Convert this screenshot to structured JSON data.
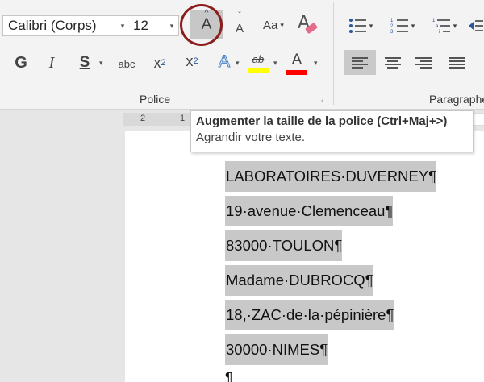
{
  "ribbon": {
    "font_name": "Calibri (Corps)",
    "font_size": "12",
    "change_case_label": "Aa",
    "bold_label": "G",
    "italic_label": "I",
    "underline_label": "S",
    "strike_label": "abc",
    "subscript_base": "x",
    "subscript_mark": "2",
    "superscript_base": "x",
    "superscript_mark": "2",
    "text_effects_label": "A",
    "highlight_label": "ab",
    "font_color_label": "A",
    "groups": {
      "font_label": "Police",
      "paragraph_label": "Paragraphe"
    },
    "colors": {
      "highlight": "#ffff00",
      "font_color": "#ff0000",
      "annotation_circle": "#8b1d1d",
      "accent_blue": "#2b5797"
    }
  },
  "tooltip": {
    "title": "Augmenter la taille de la police (Ctrl+Maj+>)",
    "description": "Agrandir votre texte."
  },
  "ruler": {
    "marks": [
      "2",
      "1"
    ]
  },
  "document": {
    "lines": [
      "LABORATOIRES·DUVERNEY¶",
      "19·avenue·Clemenceau¶",
      "83000·TOULON¶",
      "Madame·DUBROCQ¶",
      "18,·ZAC·de·la·pépinière¶",
      "30000·NIMES¶"
    ],
    "end_mark": "¶"
  }
}
